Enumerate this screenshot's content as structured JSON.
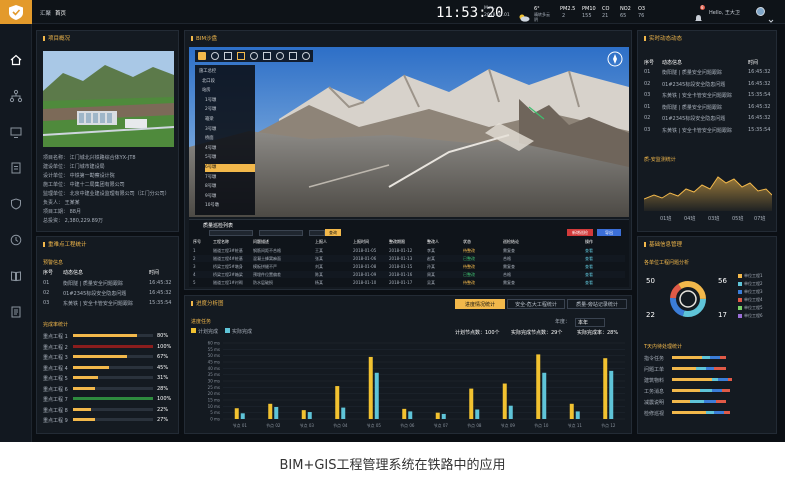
{
  "caption": "BIM+GIS工程管理系统在铁路中的应用",
  "topbar": {
    "breadcrumb_1": "汇聚",
    "breadcrumb_2": "首页",
    "clock": "11:53:20",
    "date_top": "Mon.",
    "date": "2018.02.01",
    "weather_temp": "6°",
    "weather_desc": "晴转多云",
    "weather_sub": "阴",
    "aq_labels": [
      "PM2.5",
      "PM10",
      "CO",
      "NO2",
      "O3"
    ],
    "aq_values": [
      "2",
      "155",
      "21",
      "65",
      "76"
    ],
    "user": "Hello, 王大卫",
    "notify_count": "8"
  },
  "project_panel": {
    "title": "项目概况",
    "rows": [
      "项目名称：  江门城北兴铁路综合体YX-JT8",
      "建设单位：  江门城市建设局",
      "设计单位：  中铁第一勘察设计院",
      "施工单位：  中建十二局集团有限公司",
      "监理单位：  北京中建业建设监理有限公司（江门分公司）",
      "负责人：  王某某",
      "项目工期：  88月",
      "总投资：  2,380,229.89万"
    ]
  },
  "bim_panel": {
    "title": "BIM沙盘",
    "tree_items": [
      "施工总控",
      "北口段",
      "站房",
      "1号墩",
      "2号墩",
      "箱梁",
      "3号墩",
      "桥面",
      "4号墩",
      "5号墩",
      "6号墩",
      "7号墩",
      "8号墩",
      "9号墩",
      "10号墩"
    ]
  },
  "bim_table": {
    "title": "质量巡检列表",
    "search_btn": "查询",
    "btn_red": "新增巡检",
    "btn_blue": "导出",
    "headers": [
      "序号",
      "工程名称",
      "问题描述",
      "上报人",
      "上报时间",
      "整改期限",
      "整改人",
      "状态",
      "巡检结论",
      "操作"
    ],
    "rows": [
      [
        "1",
        "隧道工程3#桩基",
        "钢筋间距不合格",
        "王某",
        "2018-01-05",
        "2018-01-12",
        "李某",
        "待整改",
        "需复查",
        "查看"
      ],
      [
        "2",
        "隧道工程4#桩基",
        "混凝土蜂窝麻面",
        "张某",
        "2018-01-06",
        "2018-01-13",
        "赵某",
        "已整改",
        "合格",
        "查看"
      ],
      [
        "3",
        "桥梁工程5#墩身",
        "模板拼缝不严",
        "刘某",
        "2018-01-08",
        "2018-01-15",
        "孙某",
        "待整改",
        "需复查",
        "查看"
      ],
      [
        "4",
        "桥梁工程2#箱梁",
        "预埋件位置偏差",
        "陈某",
        "2018-01-09",
        "2018-01-16",
        "周某",
        "已整改",
        "合格",
        "查看"
      ],
      [
        "5",
        "隧道工程1#衬砌",
        "防水层破损",
        "杨某",
        "2018-01-10",
        "2018-01-17",
        "吴某",
        "待整改",
        "需复查",
        "查看"
      ]
    ]
  },
  "key_panel": {
    "title": "重难点工程统计",
    "sub1": "预警信息",
    "headers": [
      "序号",
      "动态信息",
      "时间"
    ],
    "rows": [
      [
        "01",
        "衡阳隧 | 质量安全问题跟踪",
        "16:45:32"
      ],
      [
        "02",
        "01#2345标段安全隐患问题",
        "16:45:32"
      ],
      [
        "03",
        "东黄铁 | 安全卡管安全问题跟踪",
        "15:35:54"
      ]
    ],
    "sub2": "完成率统计",
    "bars": [
      {
        "label": "重点工程 1",
        "value": 80,
        "text": "80%",
        "color": "#f2b84b"
      },
      {
        "label": "重点工程 2",
        "value": 100,
        "text": "100%",
        "color": "#8b1d1d"
      },
      {
        "label": "重点工程 3",
        "value": 67,
        "text": "67%",
        "color": "#f2b84b"
      },
      {
        "label": "重点工程 4",
        "value": 45,
        "text": "45%",
        "color": "#f2b84b"
      },
      {
        "label": "重点工程 5",
        "value": 31,
        "text": "31%",
        "color": "#f2b84b"
      },
      {
        "label": "重点工程 6",
        "value": 28,
        "text": "28%",
        "color": "#f2b84b"
      },
      {
        "label": "重点工程 7",
        "value": 100,
        "text": "100%",
        "color": "#2e8b3e"
      },
      {
        "label": "重点工程 8",
        "value": 22,
        "text": "22%",
        "color": "#f2b84b"
      },
      {
        "label": "重点工程 9",
        "value": 27,
        "text": "27%",
        "color": "#f2b84b"
      }
    ]
  },
  "progress_panel": {
    "title": "进度分析图",
    "tabs": [
      "进度情况统计",
      "安全-危大工程统计",
      "质量-旁站记录统计"
    ],
    "legend_title": "进度任务",
    "legend_planned": "计划完成",
    "legend_actual": "实际完成",
    "stats": {
      "plan": "计划节点数：100个",
      "actual": "实际完成节点数：29个",
      "rate": "实际完成率：28%"
    },
    "year_label": "年度：",
    "year_value": "本年"
  },
  "chart_data": {
    "type": "bar",
    "categories": [
      "节点 01",
      "节点 02",
      "节点 03",
      "节点 04",
      "节点 05",
      "节点 06",
      "节点 07",
      "节点 08",
      "节点 09",
      "节点 10",
      "节点 11",
      "节点 12"
    ],
    "series": [
      {
        "name": "计划完成",
        "values": [
          8.5,
          12,
          7,
          26,
          49,
          8,
          5,
          24,
          28,
          51,
          12,
          48
        ],
        "color": "#f2c230"
      },
      {
        "name": "实际完成",
        "values": [
          4.5,
          9.5,
          5.5,
          9,
          36.5,
          6,
          4,
          7.5,
          10.5,
          36.5,
          6,
          38
        ],
        "color": "#5fc4d8"
      }
    ],
    "ylim": [
      0,
      60
    ],
    "yticks": [
      "0 ms",
      "5 ms",
      "10 ms",
      "15 ms",
      "20 ms",
      "25 ms",
      "30 ms",
      "35 ms",
      "40 ms",
      "45 ms",
      "50 ms",
      "55 ms",
      "60 ms"
    ],
    "grid": true
  },
  "dynamic_panel": {
    "title": "实时动态动态",
    "headers": [
      "序号",
      "动态信息",
      "时间"
    ],
    "rows": [
      [
        "01",
        "衡阳隧 | 质量安全问题跟踪",
        "16:45:32"
      ],
      [
        "02",
        "01#2345标段安全隐患问题",
        "16:45:32"
      ],
      [
        "03",
        "东黄铁 | 安全卡管安全问题跟踪",
        "15:35:54"
      ],
      [
        "01",
        "衡阳隧 | 质量安全问题跟踪",
        "16:45:32"
      ],
      [
        "02",
        "01#2345标段安全隐患问题",
        "16:45:32"
      ],
      [
        "03",
        "东黄铁 | 安全卡管安全问题跟踪",
        "15:35:54"
      ]
    ],
    "trend_title": "质-安监测统计",
    "trend_x": [
      "01班",
      "04班",
      "03班",
      "05班",
      "07班"
    ]
  },
  "org_panel": {
    "title": "基础信息管理",
    "sub": "各单位工程问题分析",
    "nums": {
      "tl": "50",
      "tr": "56",
      "bl": "22",
      "br": "17"
    },
    "legend": [
      "单位工程1",
      "单位工程2",
      "单位工程3",
      "单位工程4",
      "单位工程5",
      "单位工程6"
    ],
    "colors": [
      "#f2b84b",
      "#5fc4d8",
      "#3b7dd8",
      "#e05a47",
      "#7bd36a",
      "#9a6dd7"
    ],
    "sub2": "T天内待处理统计",
    "rows": [
      "指令任务",
      "问题工单",
      "建筑物料",
      "工务消息",
      "减震说明",
      "检修巡视"
    ]
  }
}
